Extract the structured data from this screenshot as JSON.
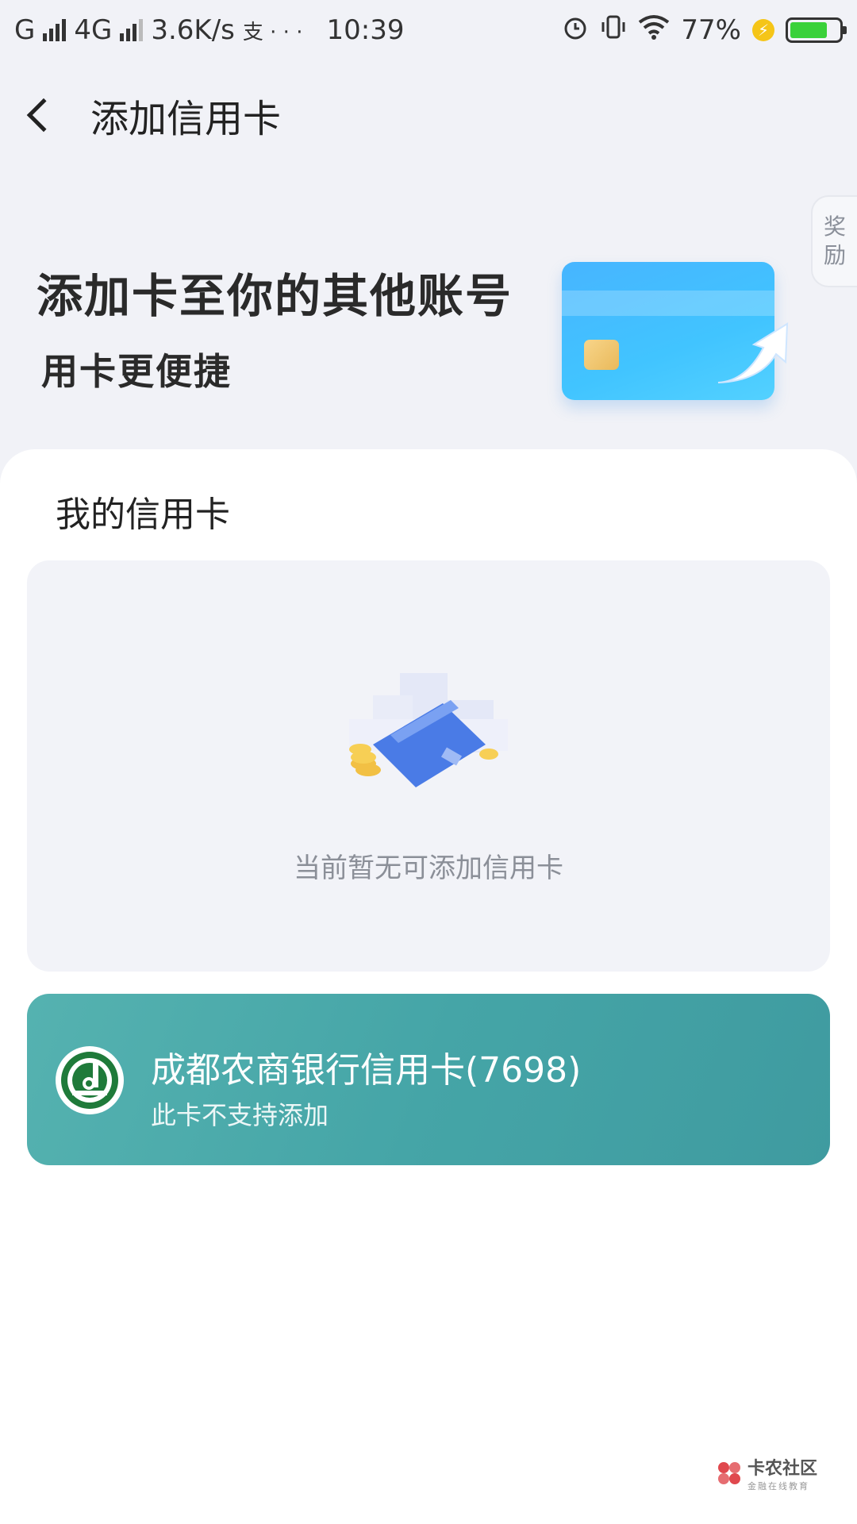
{
  "status_bar": {
    "carrier_1": "G",
    "carrier_2": "4G",
    "net_speed": "3.6K/s",
    "extra": "支 · · ·",
    "time": "10:39",
    "battery": "77%",
    "battery_level": 0.77
  },
  "nav": {
    "title": "添加信用卡"
  },
  "reward_tab": {
    "line1": "奖",
    "line2": "励"
  },
  "hero": {
    "title": "添加卡至你的其他账号",
    "subtitle": "用卡更便捷"
  },
  "my_cards": {
    "section_title": "我的信用卡",
    "empty_text": "当前暂无可添加信用卡"
  },
  "bank_card": {
    "name": "成都农商银行信用卡(7698)",
    "note": "此卡不支持添加"
  },
  "watermark": {
    "main": "卡农社区",
    "sub": "金融在线教育"
  },
  "colors": {
    "bank_card": "#45a5a7",
    "bank_logo": "#1f7a3a",
    "hero_card": "#47b5ff",
    "empty_text": "#8b8f98"
  }
}
